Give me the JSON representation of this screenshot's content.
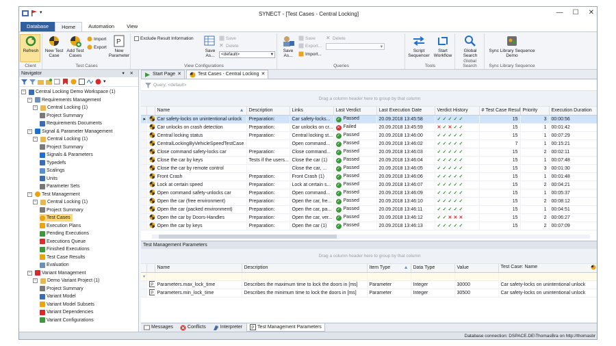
{
  "window": {
    "title": "SYNECT - [Test Cases - Central Locking]"
  },
  "ribbon": {
    "tabs": [
      "Database",
      "Home",
      "Automation",
      "View"
    ],
    "client": {
      "refresh": "Refresh",
      "label": "Client"
    },
    "testcases": {
      "new": "New Test Case",
      "add": "Add Test Cases",
      "import": "Import",
      "export": "Export",
      "new_param": "New Parameter",
      "label": "Test Cases"
    },
    "viewconf": {
      "exclude": "Exclude Result Information",
      "save_as": "Save As...",
      "save": "Save",
      "delete": "Delete",
      "default": "<default>",
      "label": "View Configurations"
    },
    "queries": {
      "save_as": "Save As...",
      "save": "Save",
      "export": "Export...",
      "import": "Import...",
      "delete": "Delete",
      "label": "Queries"
    },
    "tools": {
      "script": "Script Sequencer",
      "start": "Start Workflow",
      "label": "Tools"
    },
    "search": {
      "global": "Global Search",
      "label": "Global Search"
    },
    "sync": {
      "btn": "Sync Library Sequence Demo",
      "label": "Sync Library Sequence"
    }
  },
  "navigator": {
    "title": "Navigator",
    "pin": "▾ ✕",
    "tree": [
      {
        "label": "Central Locking Demo Workspace (1)",
        "icon": "workspace-icon",
        "level": 0,
        "expander": "⊟"
      },
      {
        "label": "Requirements Management",
        "icon": "requirements-icon",
        "level": 1,
        "expander": "⊟"
      },
      {
        "label": "Central Locking (1)",
        "icon": "folder-icon",
        "level": 2,
        "expander": "⊟"
      },
      {
        "label": "Project Summary",
        "icon": "summary-icon",
        "level": 3,
        "expander": ""
      },
      {
        "label": "Requirements Documents",
        "icon": "documents-icon",
        "level": 3,
        "expander": ""
      },
      {
        "label": "Signal & Parameter Management",
        "icon": "signal-icon",
        "level": 1,
        "expander": "⊟"
      },
      {
        "label": "Central Locking (1)",
        "icon": "folder-icon",
        "level": 2,
        "expander": "⊟"
      },
      {
        "label": "Project Summary",
        "icon": "summary-icon",
        "level": 3,
        "expander": ""
      },
      {
        "label": "Signals & Parameters",
        "icon": "signals-icon",
        "level": 3,
        "expander": ""
      },
      {
        "label": "Typedefs",
        "icon": "typedefs-icon",
        "level": 3,
        "expander": ""
      },
      {
        "label": "Scalings",
        "icon": "scalings-icon",
        "level": 3,
        "expander": ""
      },
      {
        "label": "Units",
        "icon": "units-icon",
        "level": 3,
        "expander": ""
      },
      {
        "label": "Parameter Sets",
        "icon": "parameter-sets-icon",
        "level": 3,
        "expander": ""
      },
      {
        "label": "Test Management",
        "icon": "test-management-icon",
        "level": 1,
        "expander": "⊟"
      },
      {
        "label": "Central Locking (1)",
        "icon": "folder-icon",
        "level": 2,
        "expander": "⊟"
      },
      {
        "label": "Project Summary",
        "icon": "summary-icon",
        "level": 3,
        "expander": ""
      },
      {
        "label": "Test Cases",
        "icon": "test-cases-icon",
        "level": 3,
        "expander": "",
        "selected": true
      },
      {
        "label": "Execution Plans",
        "icon": "execution-plans-icon",
        "level": 3,
        "expander": ""
      },
      {
        "label": "Pending Executions",
        "icon": "pending-icon",
        "level": 3,
        "expander": ""
      },
      {
        "label": "Executions Queue",
        "icon": "queue-icon",
        "level": 3,
        "expander": ""
      },
      {
        "label": "Finished Executions",
        "icon": "finished-icon",
        "level": 3,
        "expander": ""
      },
      {
        "label": "Test Case Results",
        "icon": "results-icon",
        "level": 3,
        "expander": ""
      },
      {
        "label": "Evaluation",
        "icon": "evaluation-icon",
        "level": 3,
        "expander": ""
      },
      {
        "label": "Variant Management",
        "icon": "variant-icon",
        "level": 1,
        "expander": "⊟"
      },
      {
        "label": "Demo Variant Project (1)",
        "icon": "folder-icon",
        "level": 2,
        "expander": "⊟"
      },
      {
        "label": "Project Summary",
        "icon": "summary-icon",
        "level": 3,
        "expander": ""
      },
      {
        "label": "Variant Model",
        "icon": "variant-model-icon",
        "level": 3,
        "expander": ""
      },
      {
        "label": "Variant Model Subsets",
        "icon": "subsets-icon",
        "level": 3,
        "expander": ""
      },
      {
        "label": "Variant Dependencies",
        "icon": "dependencies-icon",
        "level": 3,
        "expander": ""
      },
      {
        "label": "Variant Configurations",
        "icon": "configurations-icon",
        "level": 3,
        "expander": ""
      }
    ]
  },
  "doc_tabs": [
    {
      "label": "Start Page",
      "active": false
    },
    {
      "label": "Test Cases - Central Locking",
      "active": true
    }
  ],
  "grid": {
    "query": "Query: <default>",
    "group_hint": "Drag a column header here to group by that column",
    "columns": [
      "Name",
      "Description",
      "Links",
      "Last Verdict",
      "Last Execution Date",
      "Verdict History",
      "# Test Case Results",
      "Priority",
      "Execution Duration"
    ],
    "rows": [
      {
        "name": "Car safety-locks on unintentional unlock",
        "desc": "Preparation:",
        "links": "Car safety-locks...",
        "verdict": "Passed",
        "vtype": "pass",
        "date": "20.09.2018 13:45:58",
        "hist": "ppppp",
        "results": "15",
        "prio": "3",
        "dur": "00:00:56",
        "sel": true
      },
      {
        "name": "Car unlocks on crash detection",
        "desc": "Preparation:",
        "links": "Car unlocks on cr...",
        "verdict": "Failed",
        "vtype": "fail",
        "date": "20.09.2018 13:45:59",
        "hist": "fpfpp",
        "results": "15",
        "prio": "1",
        "dur": "00:01:42"
      },
      {
        "name": "Central locking status",
        "desc": "Preparation:",
        "links": "Central locking st...",
        "verdict": "Passed",
        "vtype": "pass",
        "date": "20.09.2018 13:46:00",
        "hist": "ppppp",
        "results": "15",
        "prio": "1",
        "dur": "00:07:29"
      },
      {
        "name": "CentralLockingByVehicleSpeedTestCase",
        "desc": "",
        "links": "Open command...",
        "verdict": "Passed",
        "vtype": "pass",
        "date": "20.09.2018 13:46:02",
        "hist": "ppppp",
        "results": "7",
        "prio": "1",
        "dur": "00:15:21"
      },
      {
        "name": "Close command safety-locks car",
        "desc": "Preparation:",
        "links": "Close command...",
        "verdict": "Passed",
        "vtype": "pass",
        "date": "20.09.2018 13:46:03",
        "hist": "ppppp",
        "results": "15",
        "prio": "2",
        "dur": "00:02:11"
      },
      {
        "name": "Close the car by keys",
        "desc": "Tests if the users...",
        "links": "Close the car (1)",
        "verdict": "Passed",
        "vtype": "pass",
        "date": "20.09.2018 13:46:04",
        "hist": "ppppp",
        "results": "15",
        "prio": "1",
        "dur": "00:07:48"
      },
      {
        "name": "Close the car by remote control",
        "desc": "",
        "links": "Close the car, ...",
        "verdict": "Passed",
        "vtype": "pass",
        "date": "20.09.2018 13:46:05",
        "hist": "ppppp",
        "results": "15",
        "prio": "3",
        "dur": "00:01:30"
      },
      {
        "name": "Front Crash",
        "desc": "Preparation:",
        "links": "Front Crash (1)",
        "verdict": "Passed",
        "vtype": "pass",
        "date": "20.09.2018 13:46:06",
        "hist": "ppppp",
        "results": "15",
        "prio": "1",
        "dur": "00:01:48"
      },
      {
        "name": "Lock at certain speed",
        "desc": "Preparation:",
        "links": "Lock at certain s...",
        "verdict": "Passed",
        "vtype": "pass",
        "date": "20.09.2018 13:46:07",
        "hist": "ppppp",
        "results": "15",
        "prio": "2",
        "dur": "00:04:21"
      },
      {
        "name": "Open command safety-unlocks car",
        "desc": "Preparation:",
        "links": "Open command...",
        "verdict": "Passed",
        "vtype": "pass",
        "date": "20.09.2018 13:46:09",
        "hist": "ppppp",
        "results": "15",
        "prio": "1",
        "dur": "00:05:37"
      },
      {
        "name": "Open the car (free environment)",
        "desc": "Preparation:",
        "links": "Open the car, fre...",
        "verdict": "Passed",
        "vtype": "pass",
        "date": "20.09.2018 13:46:10",
        "hist": "ppppp",
        "results": "15",
        "prio": "2",
        "dur": "00:08:12"
      },
      {
        "name": "Open the car (packed environment)",
        "desc": "Preparation:",
        "links": "Open the car, pa...",
        "verdict": "Passed",
        "vtype": "pass",
        "date": "20.09.2018 13:46:11",
        "hist": "ppppp",
        "results": "15",
        "prio": "1",
        "dur": "00:04:51"
      },
      {
        "name": "Open the car by Doors-Handles",
        "desc": "Preparation:",
        "links": "Open the car, ver...",
        "verdict": "Passed",
        "vtype": "pass",
        "date": "20.09.2018 13:46:12",
        "hist": "ppfff",
        "results": "15",
        "prio": "2",
        "dur": "00:06:27"
      },
      {
        "name": "Open the car by keys",
        "desc": "Preparation:",
        "links": "Open the car (1)",
        "verdict": "Passed",
        "vtype": "pass",
        "date": "20.09.2018 13:46:13",
        "hist": "ppppp",
        "results": "15",
        "prio": "2",
        "dur": "00:07:09"
      }
    ]
  },
  "params": {
    "title": "Test Management Parameters",
    "group_hint": "Drag a column header here to group by that column",
    "columns": [
      "Name",
      "Description",
      "Item Type",
      "Data Type",
      "Value",
      "Test Case: Name"
    ],
    "rows": [
      {
        "name": "Parameters.max_lock_time",
        "desc": "Describes the maximum time to lock the doors in [ms]",
        "itype": "Parameter",
        "dtype": "Integer",
        "value": "30000",
        "tc": "Car safety-locks on unintentional unlock"
      },
      {
        "name": "Parameters.min_lock_time",
        "desc": "Describes the minimum time to lock the doors in [ms]",
        "itype": "Parameter",
        "dtype": "Integer",
        "value": "30500",
        "tc": "Car safety-locks on unintentional unlock"
      }
    ]
  },
  "bottom_tabs": [
    {
      "label": "Messages",
      "icon": "messages-icon"
    },
    {
      "label": "Conflicts",
      "icon": "conflicts-icon"
    },
    {
      "label": "Interpreter",
      "icon": "interpreter-icon"
    },
    {
      "label": "Test Management Parameters",
      "icon": "parameter-icon",
      "active": true
    }
  ],
  "status": {
    "text": "Database connection: DSPACE.DE\\ThomasBra on http://thomasbr"
  },
  "colors": {
    "accent": "#2f5f9e",
    "selection": "#cfe3fb",
    "tree_selection": "#fbd87a",
    "pass": "#3a9a3a",
    "fail": "#d63030"
  }
}
